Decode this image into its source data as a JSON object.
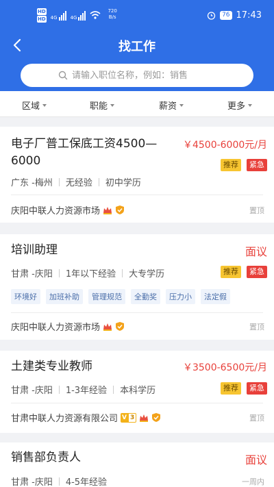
{
  "status": {
    "hd1": "HD",
    "hd2": "HD",
    "net1": "4G",
    "net2": "4G",
    "speed_value": "720",
    "speed_unit": "B/s",
    "battery": "76",
    "time": "17:43"
  },
  "header": {
    "title": "找工作",
    "back_icon": "chevron-left-icon"
  },
  "search": {
    "placeholder": "请输入职位名称，例如：销售",
    "icon": "search-icon"
  },
  "filters": [
    {
      "label": "区域"
    },
    {
      "label": "职能"
    },
    {
      "label": "薪资"
    },
    {
      "label": "更多"
    }
  ],
  "jobs": [
    {
      "title_line1": "电子厂普工保底工资4500—",
      "title_line2": "6000",
      "salary": "￥4500-6000元/月",
      "tags": [
        "推荐",
        "紧急"
      ],
      "location": "广东 -梅州",
      "experience": "无经验",
      "education": "初中学历",
      "company": "庆阳中联人力资源市场",
      "pin": "置顶"
    },
    {
      "title": "培训助理",
      "salary": "面议",
      "tags": [
        "推荐",
        "紧急"
      ],
      "location": "甘肃 -庆阳",
      "experience": "1年以下经验",
      "education": "大专学历",
      "benefits": [
        "环境好",
        "加班补助",
        "管理规范",
        "全勤奖",
        "压力小",
        "法定假"
      ],
      "company": "庆阳中联人力资源市场",
      "pin": "置顶"
    },
    {
      "title": "土建类专业教师",
      "salary": "￥3500-6500元/月",
      "tags": [
        "推荐",
        "紧急"
      ],
      "location": "甘肃 -庆阳",
      "experience": "1-3年经验",
      "education": "本科学历",
      "company": "甘肃中联人力资源有限公司",
      "vip_letter": "V",
      "vip_number": "3",
      "pin": "置顶"
    },
    {
      "title": "销售部负责人",
      "salary": "面议",
      "location": "甘肃 -庆阳",
      "experience": "4-5年经验",
      "posted": "一周内"
    }
  ],
  "colors": {
    "brand": "#2f6fe6",
    "salary": "#e8403a",
    "recommend": "#f7c531",
    "urgent": "#e8403a",
    "benefit_bg": "#eef3fb",
    "benefit_text": "#4a6ea9"
  }
}
